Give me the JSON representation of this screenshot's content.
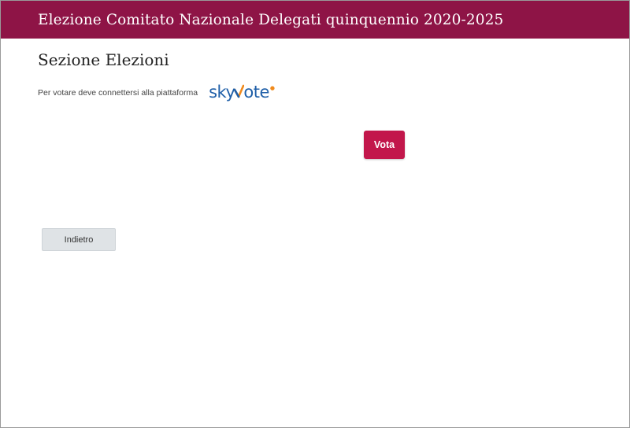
{
  "header": {
    "title": "Elezione Comitato Nazionale Delegati quinquennio 2020-2025",
    "color": "#8e1446"
  },
  "main": {
    "section_title": "Sezione Elezioni",
    "connect_text": "Per votare deve connettersi alla piattaforma",
    "logo": {
      "part1": "sky",
      "part2": "ote",
      "icon": "checkmark-v-icon",
      "colors": {
        "text": "#1f5fa8",
        "check": "#f08a1c"
      }
    },
    "vote_label": "Vota",
    "vote_color": "#c2174b",
    "back_label": "Indietro"
  }
}
